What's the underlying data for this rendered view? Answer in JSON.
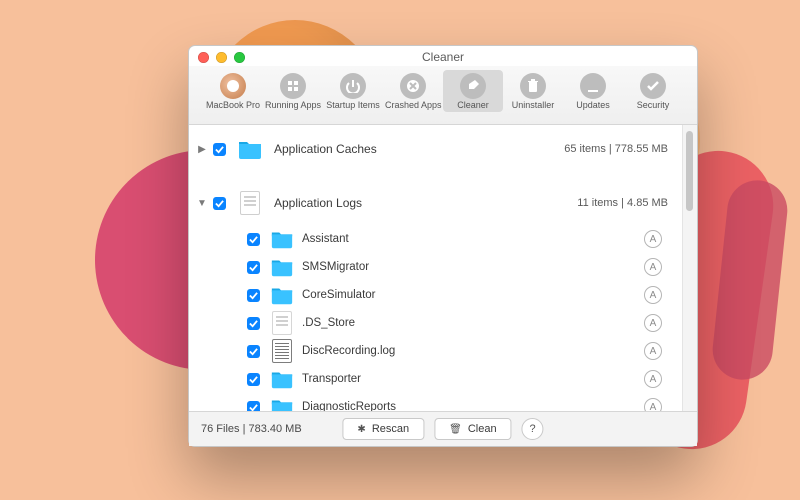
{
  "window": {
    "title": "Cleaner"
  },
  "toolbar": {
    "items": [
      {
        "label": "MacBook Pro",
        "icon": "device-icon"
      },
      {
        "label": "Running Apps",
        "icon": "apps-icon"
      },
      {
        "label": "Startup Items",
        "icon": "power-icon"
      },
      {
        "label": "Crashed Apps",
        "icon": "crashed-icon"
      },
      {
        "label": "Cleaner",
        "icon": "broom-icon"
      },
      {
        "label": "Uninstaller",
        "icon": "trash-icon"
      },
      {
        "label": "Updates",
        "icon": "download-icon"
      },
      {
        "label": "Security",
        "icon": "check-icon"
      }
    ],
    "active_index": 4
  },
  "groups": [
    {
      "name": "Application Caches",
      "expanded": false,
      "checked": true,
      "count_label": "65 items",
      "size_label": "778.55 MB",
      "icon": "folder-blue"
    },
    {
      "name": "Application Logs",
      "expanded": true,
      "checked": true,
      "count_label": "11 items",
      "size_label": "4.85 MB",
      "icon": "doc-icon",
      "children": [
        {
          "name": "Assistant",
          "icon": "folder-blue",
          "checked": true
        },
        {
          "name": "SMSMigrator",
          "icon": "folder-blue",
          "checked": true
        },
        {
          "name": "CoreSimulator",
          "icon": "folder-blue",
          "checked": true
        },
        {
          "name": ".DS_Store",
          "icon": "file-icon",
          "checked": true
        },
        {
          "name": "DiscRecording.log",
          "icon": "log-icon",
          "checked": true
        },
        {
          "name": "Transporter",
          "icon": "folder-blue",
          "checked": true
        },
        {
          "name": "DiagnosticReports",
          "icon": "folder-blue",
          "checked": true
        }
      ]
    }
  ],
  "footer": {
    "status": "76 Files | 783.40 MB",
    "rescan_label": "Rescan",
    "clean_label": "Clean",
    "help_label": "?"
  }
}
